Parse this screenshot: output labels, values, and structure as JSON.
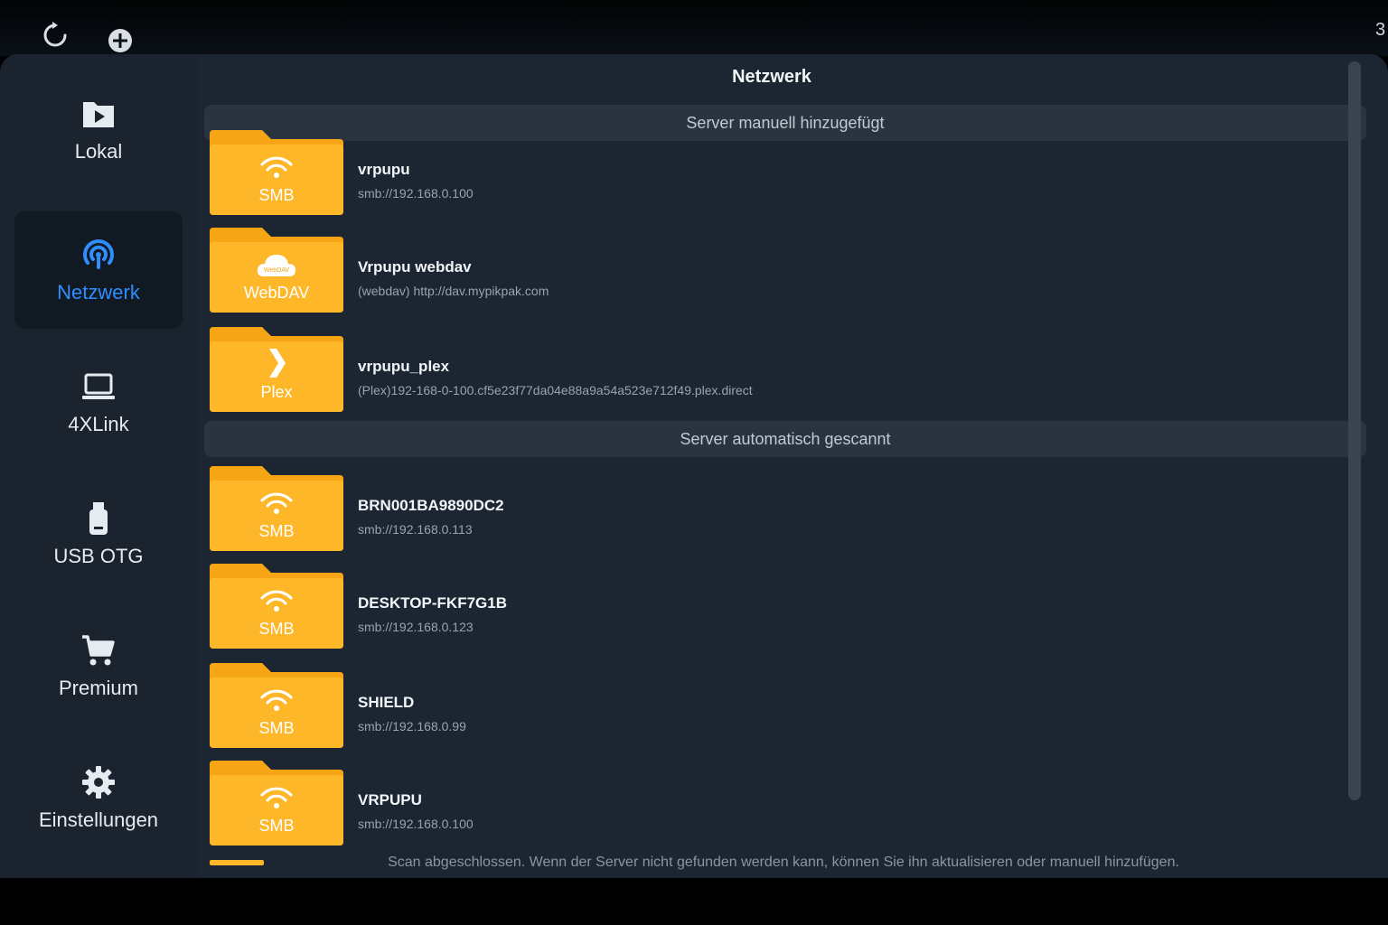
{
  "colors": {
    "accent": "#2f8dff",
    "folder": "#ffb72a",
    "folder_tab": "#f6a514",
    "background": "#1c2632"
  },
  "toolbar": {
    "refresh_icon": "refresh-icon",
    "add_icon": "add-circle-icon",
    "clock_partial": "3"
  },
  "sidebar": {
    "items": [
      {
        "label": "Lokal",
        "icon": "play-folder-icon",
        "active": false
      },
      {
        "label": "Netzwerk",
        "icon": "network-signal-icon",
        "active": true
      },
      {
        "label": "4XLink",
        "icon": "laptop-icon",
        "active": false
      },
      {
        "label": "USB OTG",
        "icon": "usb-drive-icon",
        "active": false
      },
      {
        "label": "Premium",
        "icon": "cart-icon",
        "active": false
      },
      {
        "label": "Einstellungen",
        "icon": "gear-icon",
        "active": false
      }
    ]
  },
  "main": {
    "title": "Netzwerk",
    "sections": [
      {
        "header": "Server manuell hinzugefügt",
        "servers": [
          {
            "type": "SMB",
            "icon": "wifi-icon",
            "name": "vrpupu",
            "address": "smb://192.168.0.100"
          },
          {
            "type": "WebDAV",
            "icon": "cloud-icon",
            "icon_text": "WebDAV",
            "name": "Vrpupu webdav",
            "address": "(webdav) http://dav.mypikpak.com"
          },
          {
            "type": "Plex",
            "icon": "plex-chevron-icon",
            "name": "vrpupu_plex",
            "address": "(Plex)192-168-0-100.cf5e23f77da04e88a9a54a523e712f49.plex.direct"
          }
        ]
      },
      {
        "header": "Server automatisch gescannt",
        "servers": [
          {
            "type": "SMB",
            "icon": "wifi-icon",
            "name": "BRN001BA9890DC2",
            "address": "smb://192.168.0.113"
          },
          {
            "type": "SMB",
            "icon": "wifi-icon",
            "name": "DESKTOP-FKF7G1B",
            "address": "smb://192.168.0.123"
          },
          {
            "type": "SMB",
            "icon": "wifi-icon",
            "name": "SHIELD",
            "address": "smb://192.168.0.99"
          },
          {
            "type": "SMB",
            "icon": "wifi-icon",
            "name": "VRPUPU",
            "address": "smb://192.168.0.100"
          }
        ]
      }
    ],
    "footer": "Scan abgeschlossen. Wenn der Server nicht gefunden werden kann, können Sie ihn aktualisieren oder manuell hinzufügen."
  }
}
